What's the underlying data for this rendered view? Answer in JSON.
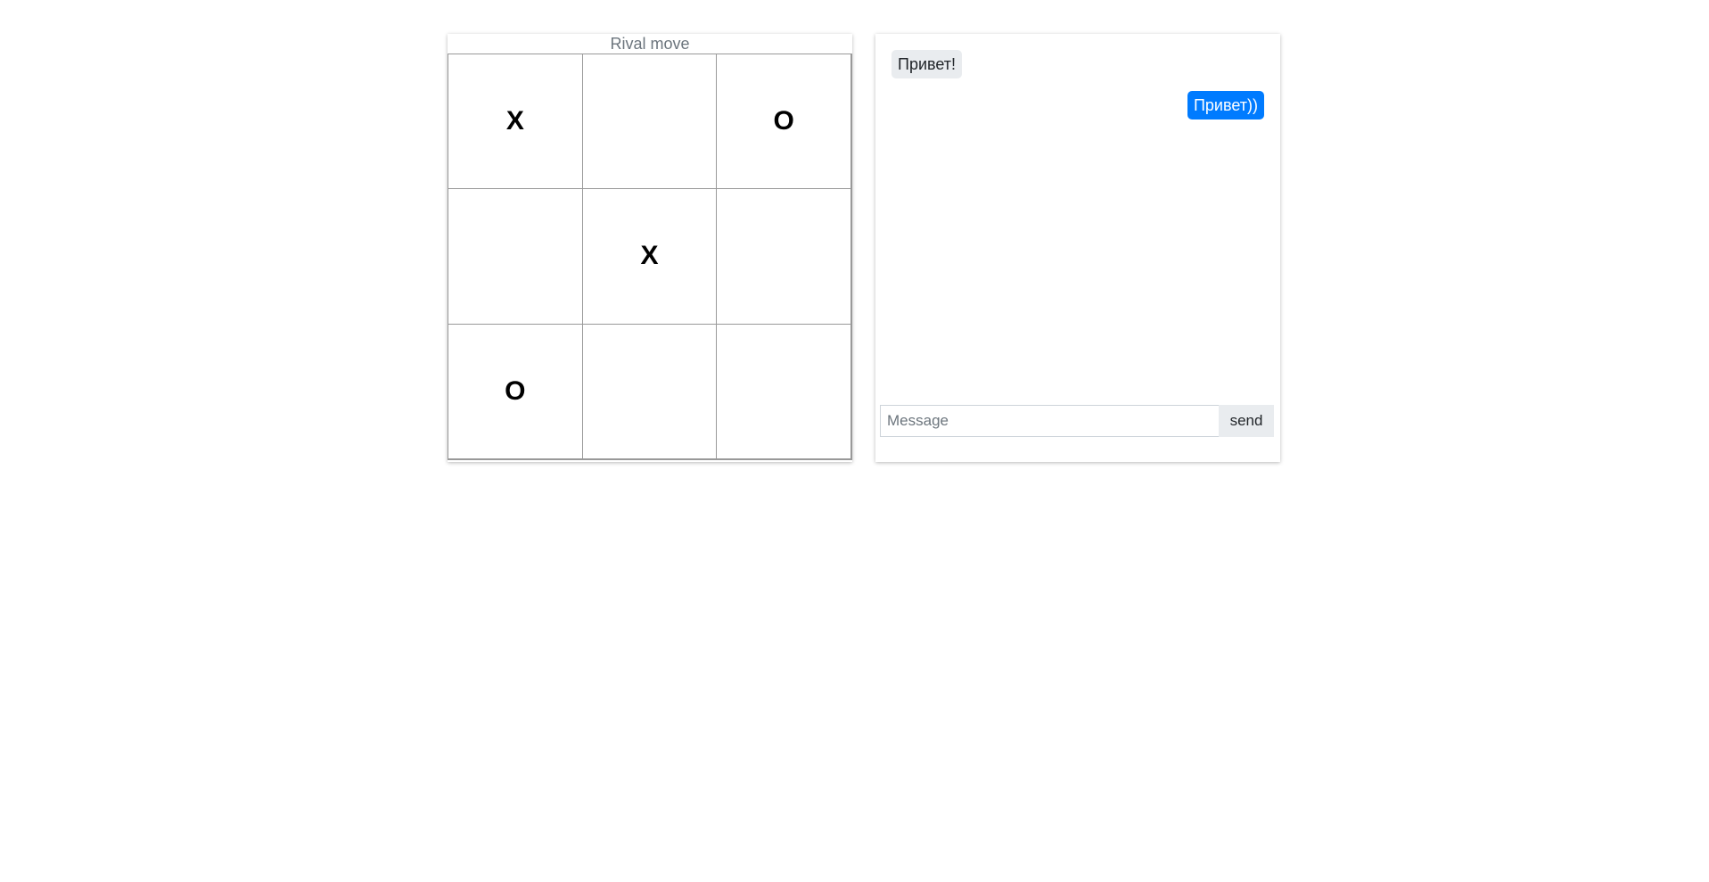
{
  "game": {
    "status": "Rival move",
    "board": [
      [
        "X",
        "",
        "O"
      ],
      [
        "",
        "X",
        ""
      ],
      [
        "O",
        "",
        ""
      ]
    ]
  },
  "chat": {
    "messages": [
      {
        "direction": "in",
        "text": "Привет!"
      },
      {
        "direction": "out",
        "text": "Привет))"
      }
    ],
    "input": {
      "placeholder": "Message",
      "value": ""
    },
    "send_label": "send"
  },
  "colors": {
    "outgoing_bubble": "#007bff",
    "incoming_bubble": "#e9ecef",
    "status_text": "#6c757d"
  }
}
